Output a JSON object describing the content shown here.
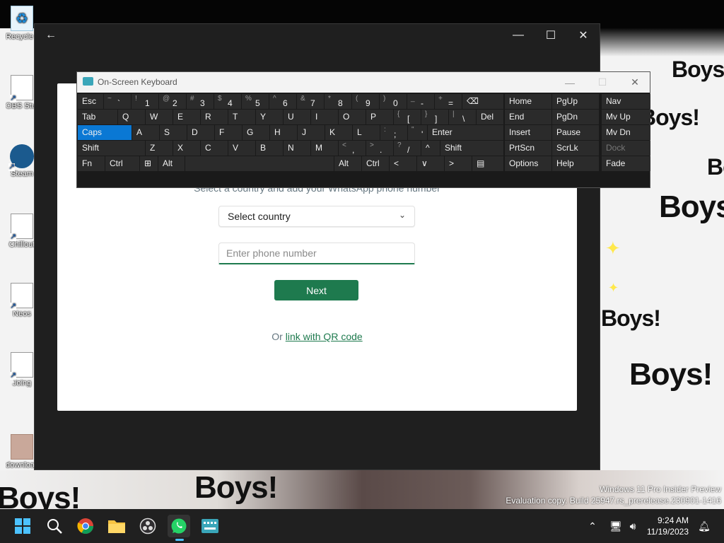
{
  "desktop": {
    "wallpaper_text": "Boys!",
    "icons": [
      {
        "label": "Recycle Bin"
      },
      {
        "label": "OBS Studio"
      },
      {
        "label": "Steam"
      },
      {
        "label": "Chillout"
      },
      {
        "label": "Neos"
      },
      {
        "label": "Joing"
      },
      {
        "label": "download"
      }
    ],
    "watermark": {
      "line1": "Windows 11 Pro Insider Preview",
      "line2": "Evaluation copy. Build 25947.rs_prerelease.230901-1416"
    }
  },
  "whatsapp": {
    "subtitle": "Select a country and add your WhatsApp phone number",
    "country_select": "Select country",
    "phone_placeholder": "Enter phone number",
    "next_label": "Next",
    "qr_prefix": "Or",
    "qr_link": "link with QR code",
    "accent": "#1e7a4e"
  },
  "osk": {
    "title": "On-Screen Keyboard",
    "active_color": "#0a78d4",
    "row1": [
      {
        "label": "Esc"
      },
      {
        "sh": "~",
        "mn": "`"
      },
      {
        "sh": "!",
        "mn": "1"
      },
      {
        "sh": "@",
        "mn": "2"
      },
      {
        "sh": "#",
        "mn": "3"
      },
      {
        "sh": "$",
        "mn": "4"
      },
      {
        "sh": "%",
        "mn": "5"
      },
      {
        "sh": "^",
        "mn": "6"
      },
      {
        "sh": "&",
        "mn": "7"
      },
      {
        "sh": "*",
        "mn": "8"
      },
      {
        "sh": "(",
        "mn": "9"
      },
      {
        "sh": ")",
        "mn": "0"
      },
      {
        "sh": "_",
        "mn": "-"
      },
      {
        "sh": "+",
        "mn": "="
      },
      {
        "label": "⌫"
      }
    ],
    "row2": [
      {
        "label": "Tab"
      },
      {
        "label": "Q"
      },
      {
        "label": "W"
      },
      {
        "label": "E"
      },
      {
        "label": "R"
      },
      {
        "label": "T"
      },
      {
        "label": "Y"
      },
      {
        "label": "U"
      },
      {
        "label": "I"
      },
      {
        "label": "O"
      },
      {
        "label": "P"
      },
      {
        "sh": "{",
        "mn": "["
      },
      {
        "sh": "}",
        "mn": "]"
      },
      {
        "sh": "|",
        "mn": "\\"
      },
      {
        "label": "Del"
      }
    ],
    "row3": [
      {
        "label": "Caps"
      },
      {
        "label": "A"
      },
      {
        "label": "S"
      },
      {
        "label": "D"
      },
      {
        "label": "F"
      },
      {
        "label": "G"
      },
      {
        "label": "H"
      },
      {
        "label": "J"
      },
      {
        "label": "K"
      },
      {
        "label": "L"
      },
      {
        "sh": ":",
        "mn": ";"
      },
      {
        "sh": "\"",
        "mn": "'"
      },
      {
        "label": "Enter"
      }
    ],
    "row4": [
      {
        "label": "Shift"
      },
      {
        "label": "Z"
      },
      {
        "label": "X"
      },
      {
        "label": "C"
      },
      {
        "label": "V"
      },
      {
        "label": "B"
      },
      {
        "label": "N"
      },
      {
        "label": "M"
      },
      {
        "sh": "<",
        "mn": ","
      },
      {
        "sh": ">",
        "mn": "."
      },
      {
        "sh": "?",
        "mn": "/"
      },
      {
        "label": "^"
      },
      {
        "label": "Shift"
      }
    ],
    "row5": [
      {
        "label": "Fn"
      },
      {
        "label": "Ctrl"
      },
      {
        "label": "⊞"
      },
      {
        "label": "Alt"
      },
      {
        "label": ""
      },
      {
        "label": "Alt"
      },
      {
        "label": "Ctrl"
      },
      {
        "label": "<"
      },
      {
        "label": "∨"
      },
      {
        "label": ">"
      },
      {
        "label": "▤"
      }
    ],
    "nav_rows": [
      [
        "Home",
        "PgUp",
        "Nav"
      ],
      [
        "End",
        "PgDn",
        "Mv Up"
      ],
      [
        "Insert",
        "Pause",
        "Mv Dn"
      ],
      [
        "PrtScn",
        "ScrLk",
        "Dock"
      ],
      [
        "Options",
        "Help",
        "Fade"
      ]
    ]
  },
  "taskbar": {
    "time": "9:24 AM",
    "date": "11/19/2023",
    "accent": "#4cc2ff"
  }
}
